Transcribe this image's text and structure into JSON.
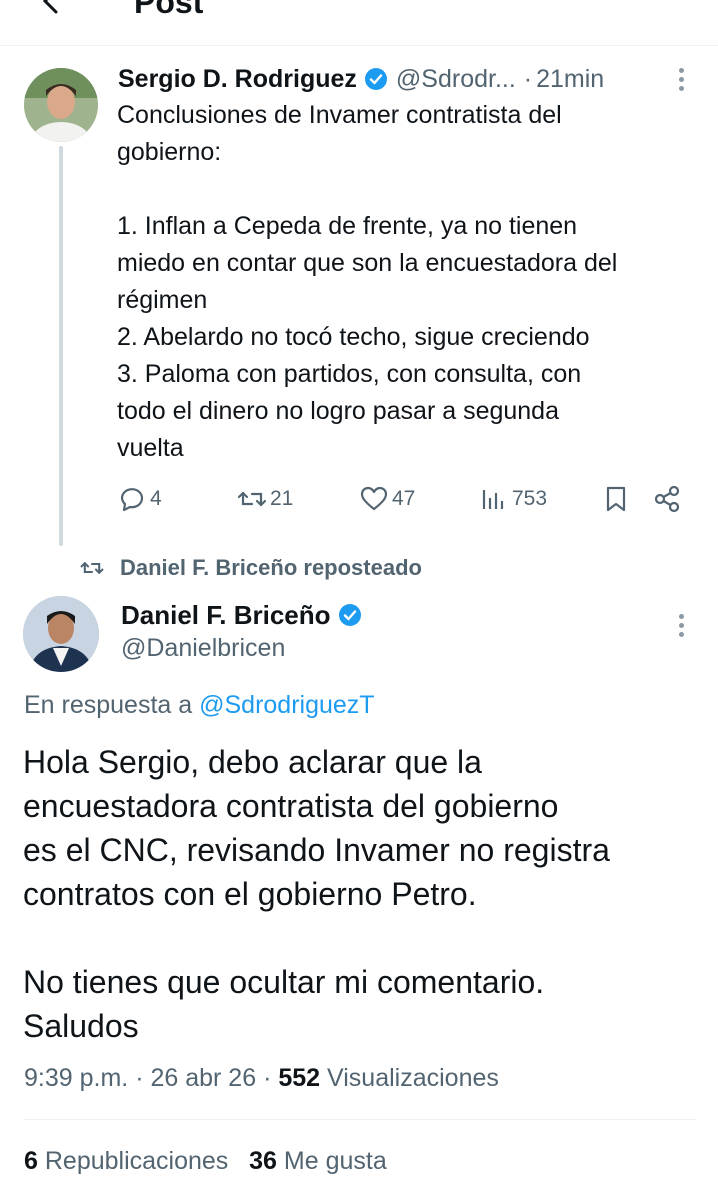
{
  "header": {
    "title": "Post"
  },
  "parent_post": {
    "author_name": "Sergio D. Rodriguez",
    "handle": "@Sdrodr...",
    "separator": "·",
    "time": "21min",
    "lines": [
      "Conclusiones de Invamer contratista del",
      "gobierno:",
      "",
      "1. Inflan a Cepeda de frente, ya no tienen",
      "miedo en contar que son la encuestadora del",
      "régimen",
      "2. Abelardo no tocó techo, sigue creciendo",
      "3. Paloma con partidos, con consulta, con",
      "todo el dinero no logro pasar a segunda",
      "vuelta"
    ],
    "actions": {
      "replies": "4",
      "reposts": "21",
      "likes": "47",
      "views": "753"
    }
  },
  "repost_banner": {
    "text": "Daniel F. Briceño reposteado"
  },
  "main_post": {
    "author_name": "Daniel F. Briceño",
    "handle": "@Danielbricen",
    "reply_prefix": "En respuesta a",
    "reply_mention": "@SdrodriguezT",
    "lines": [
      "Hola Sergio, debo aclarar que la",
      "encuestadora contratista del gobierno",
      "es el CNC, revisando Invamer no registra",
      "contratos con el gobierno Petro.",
      "",
      "No tienes que ocultar mi comentario.",
      "Saludos"
    ],
    "time": "9:39 p.m.",
    "sep1": "·",
    "date": "26 abr 26",
    "sep2": "·",
    "views_count": "552",
    "views_label": "Visualizaciones",
    "reposts_count": "6",
    "reposts_label": "Republicaciones",
    "likes_count": "36",
    "likes_label": "Me gusta"
  },
  "colors": {
    "text": "#0f1419",
    "muted": "#536471",
    "accent": "#1d9bf0",
    "divider": "#eff3f4"
  }
}
